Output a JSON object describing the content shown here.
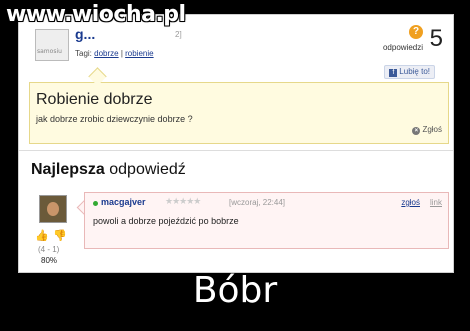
{
  "watermark": "www.wiocha.pl",
  "header": {
    "avatar_label": "samosiu",
    "user": "g...",
    "date": "2]",
    "tags_label": "Tagi:",
    "tags": [
      "dobrze",
      "robienie"
    ],
    "answers_label": "odpowiedzi",
    "answers_count": "5",
    "like_label": "Lubię to!"
  },
  "question": {
    "title": "Robienie dobrze",
    "text": "jak dobrze zrobic dziewczynie dobrze ?",
    "report": "Zgłoś"
  },
  "best_answer": {
    "heading_bold": "Najlepsza",
    "heading_rest": " odpowiedź",
    "user": "macgajver",
    "stars": "★★★★★",
    "date": "[wczoraj, 22:44]",
    "report": "zgłoś",
    "link": "link",
    "text": "powoli a dobrze pojeździć po bobrze",
    "votes": "(4 - 1)",
    "percent": "80%"
  },
  "caption": "Bóbr",
  "colors": {
    "link": "#1a3a8f",
    "question_bg": "#fffbe0",
    "answer_bg": "#fff4f4"
  }
}
